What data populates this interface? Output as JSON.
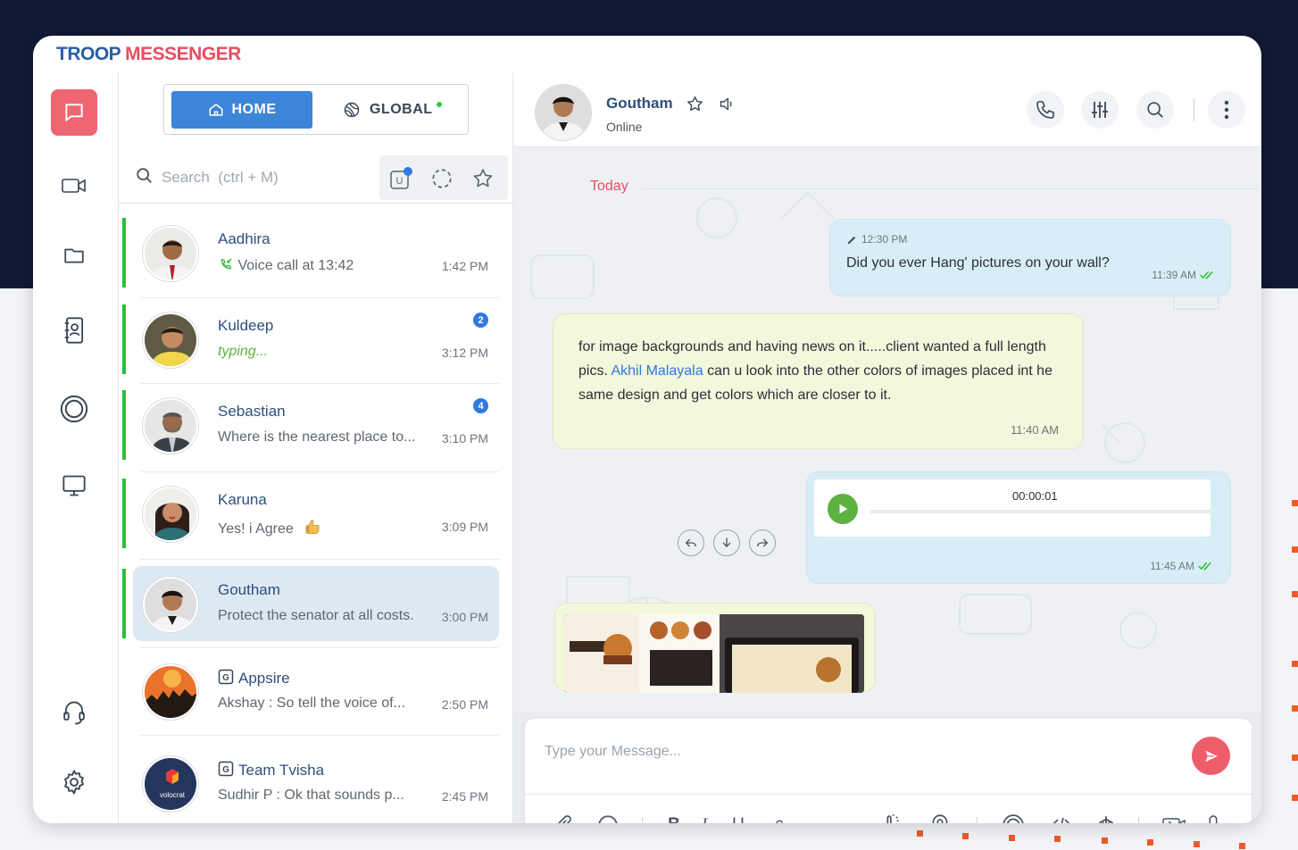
{
  "brand": {
    "part1": "TROOP",
    "part2": "MESSENGER"
  },
  "tabs": {
    "home": "HOME",
    "global": "GLOBAL"
  },
  "search": {
    "placeholder": "Search  (ctrl + M)"
  },
  "contacts": [
    {
      "name": "Aadhira",
      "message": "Voice call at 13:42",
      "time": "1:42 PM",
      "badge": "",
      "typing": false
    },
    {
      "name": "Kuldeep",
      "message": "typing...",
      "time": "3:12 PM",
      "badge": "2",
      "typing": true
    },
    {
      "name": "Sebastian",
      "message": "Where is the nearest place to...",
      "time": "3:10 PM",
      "badge": "4",
      "typing": false
    },
    {
      "name": "Karuna",
      "message": "Yes! i Agree",
      "time": "3:09 PM",
      "badge": "",
      "typing": false
    },
    {
      "name": "Goutham",
      "message": "Protect the senator at all costs.",
      "time": "3:00 PM",
      "badge": "",
      "typing": false
    },
    {
      "name": "Appsire",
      "message": "Akshay  : So tell the voice of...",
      "time": "2:50 PM",
      "badge": "",
      "typing": false
    },
    {
      "name": "Team Tvisha",
      "message": "Sudhir P : Ok that sounds p...",
      "time": "2:45 PM",
      "badge": "",
      "typing": false
    }
  ],
  "team_logo_text": "volocrat",
  "chat": {
    "name": "Goutham",
    "status": "Online",
    "day_label": "Today",
    "messages": {
      "m1_edit_time": "12:30 PM",
      "m1_text": "Did you ever Hang' pictures on your wall?",
      "m1_time": "11:39 AM",
      "m2_text_a": "for image backgrounds and having news on it.....client wanted a full length pics. ",
      "m2_mention": "Akhil Malayala",
      "m2_text_b": " can u look into the other colors of images placed int he same design and get colors which are closer to it.",
      "m2_time": "11:40 AM",
      "m3_audio_time": "00:00:01",
      "m3_time": "11:45 AM"
    }
  },
  "composer": {
    "placeholder": "Type your Message..."
  },
  "colors": {
    "accent": "#ef5d6b",
    "primary": "#3d85d8",
    "online": "#2ebd3a",
    "navy": "#111a33"
  }
}
